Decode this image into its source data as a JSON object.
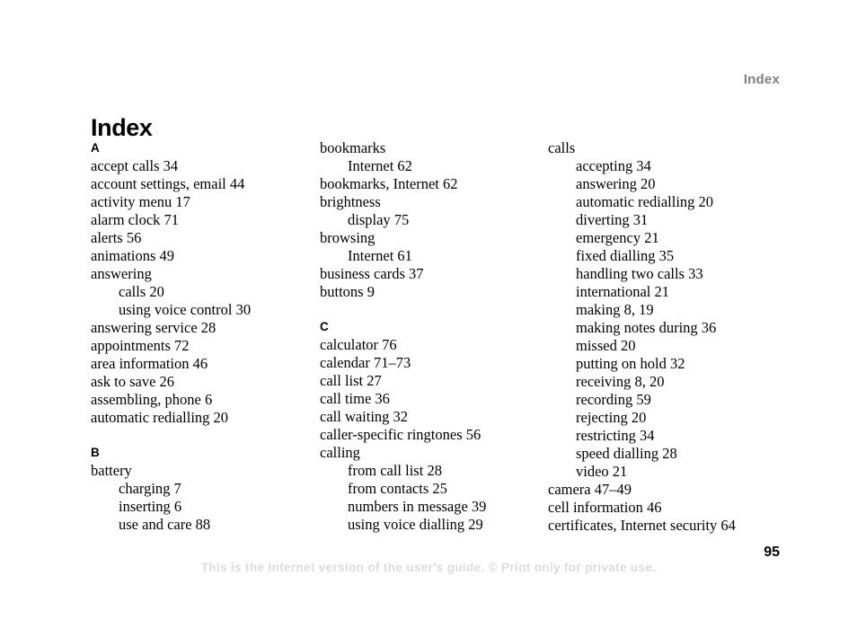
{
  "header": {
    "running_head": "Index"
  },
  "title": "Index",
  "footer": {
    "note": "This is the Internet version of the user's guide. © Print only for private use.",
    "page_number": "95"
  },
  "columns": [
    {
      "sections": [
        {
          "letter": "A",
          "entries": [
            {
              "text": "accept calls 34",
              "sub": false
            },
            {
              "text": "account settings, email 44",
              "sub": false
            },
            {
              "text": "activity menu 17",
              "sub": false
            },
            {
              "text": "alarm clock 71",
              "sub": false
            },
            {
              "text": "alerts 56",
              "sub": false
            },
            {
              "text": "animations 49",
              "sub": false
            },
            {
              "text": "answering",
              "sub": false
            },
            {
              "text": "calls 20",
              "sub": true
            },
            {
              "text": "using voice control 30",
              "sub": true
            },
            {
              "text": "answering service 28",
              "sub": false
            },
            {
              "text": "appointments 72",
              "sub": false
            },
            {
              "text": "area information 46",
              "sub": false
            },
            {
              "text": "ask to save 26",
              "sub": false
            },
            {
              "text": "assembling, phone 6",
              "sub": false
            },
            {
              "text": "automatic redialling 20",
              "sub": false
            }
          ]
        },
        {
          "letter": "B",
          "entries": [
            {
              "text": "battery",
              "sub": false
            },
            {
              "text": "charging 7",
              "sub": true
            },
            {
              "text": "inserting 6",
              "sub": true
            },
            {
              "text": "use and care 88",
              "sub": true
            }
          ]
        }
      ]
    },
    {
      "sections": [
        {
          "letter": "",
          "entries": [
            {
              "text": "bookmarks",
              "sub": false
            },
            {
              "text": "Internet 62",
              "sub": true
            },
            {
              "text": "bookmarks, Internet 62",
              "sub": false
            },
            {
              "text": "brightness",
              "sub": false
            },
            {
              "text": "display 75",
              "sub": true
            },
            {
              "text": "browsing",
              "sub": false
            },
            {
              "text": "Internet 61",
              "sub": true
            },
            {
              "text": "business cards 37",
              "sub": false
            },
            {
              "text": "buttons 9",
              "sub": false
            }
          ]
        },
        {
          "letter": "C",
          "entries": [
            {
              "text": "calculator 76",
              "sub": false
            },
            {
              "text": "calendar 71–73",
              "sub": false
            },
            {
              "text": "call list 27",
              "sub": false
            },
            {
              "text": "call time 36",
              "sub": false
            },
            {
              "text": "call waiting 32",
              "sub": false
            },
            {
              "text": "caller-specific ringtones 56",
              "sub": false
            },
            {
              "text": "calling",
              "sub": false
            },
            {
              "text": "from call list 28",
              "sub": true
            },
            {
              "text": "from contacts 25",
              "sub": true
            },
            {
              "text": "numbers in message 39",
              "sub": true
            },
            {
              "text": "using voice dialling 29",
              "sub": true
            }
          ]
        }
      ]
    },
    {
      "sections": [
        {
          "letter": "",
          "entries": [
            {
              "text": "calls",
              "sub": false
            },
            {
              "text": "accepting 34",
              "sub": true
            },
            {
              "text": "answering 20",
              "sub": true
            },
            {
              "text": "automatic redialling 20",
              "sub": true
            },
            {
              "text": "diverting 31",
              "sub": true
            },
            {
              "text": "emergency 21",
              "sub": true
            },
            {
              "text": "fixed dialling 35",
              "sub": true
            },
            {
              "text": "handling two calls 33",
              "sub": true
            },
            {
              "text": "international 21",
              "sub": true
            },
            {
              "text": "making 8, 19",
              "sub": true
            },
            {
              "text": "making notes during 36",
              "sub": true
            },
            {
              "text": "missed 20",
              "sub": true
            },
            {
              "text": "putting on hold 32",
              "sub": true
            },
            {
              "text": "receiving 8, 20",
              "sub": true
            },
            {
              "text": "recording 59",
              "sub": true
            },
            {
              "text": "rejecting 20",
              "sub": true
            },
            {
              "text": "restricting 34",
              "sub": true
            },
            {
              "text": "speed dialling 28",
              "sub": true
            },
            {
              "text": "video 21",
              "sub": true
            },
            {
              "text": "camera 47–49",
              "sub": false
            },
            {
              "text": "cell information 46",
              "sub": false
            },
            {
              "text": "certificates, Internet security 64",
              "sub": false
            }
          ]
        }
      ]
    }
  ]
}
